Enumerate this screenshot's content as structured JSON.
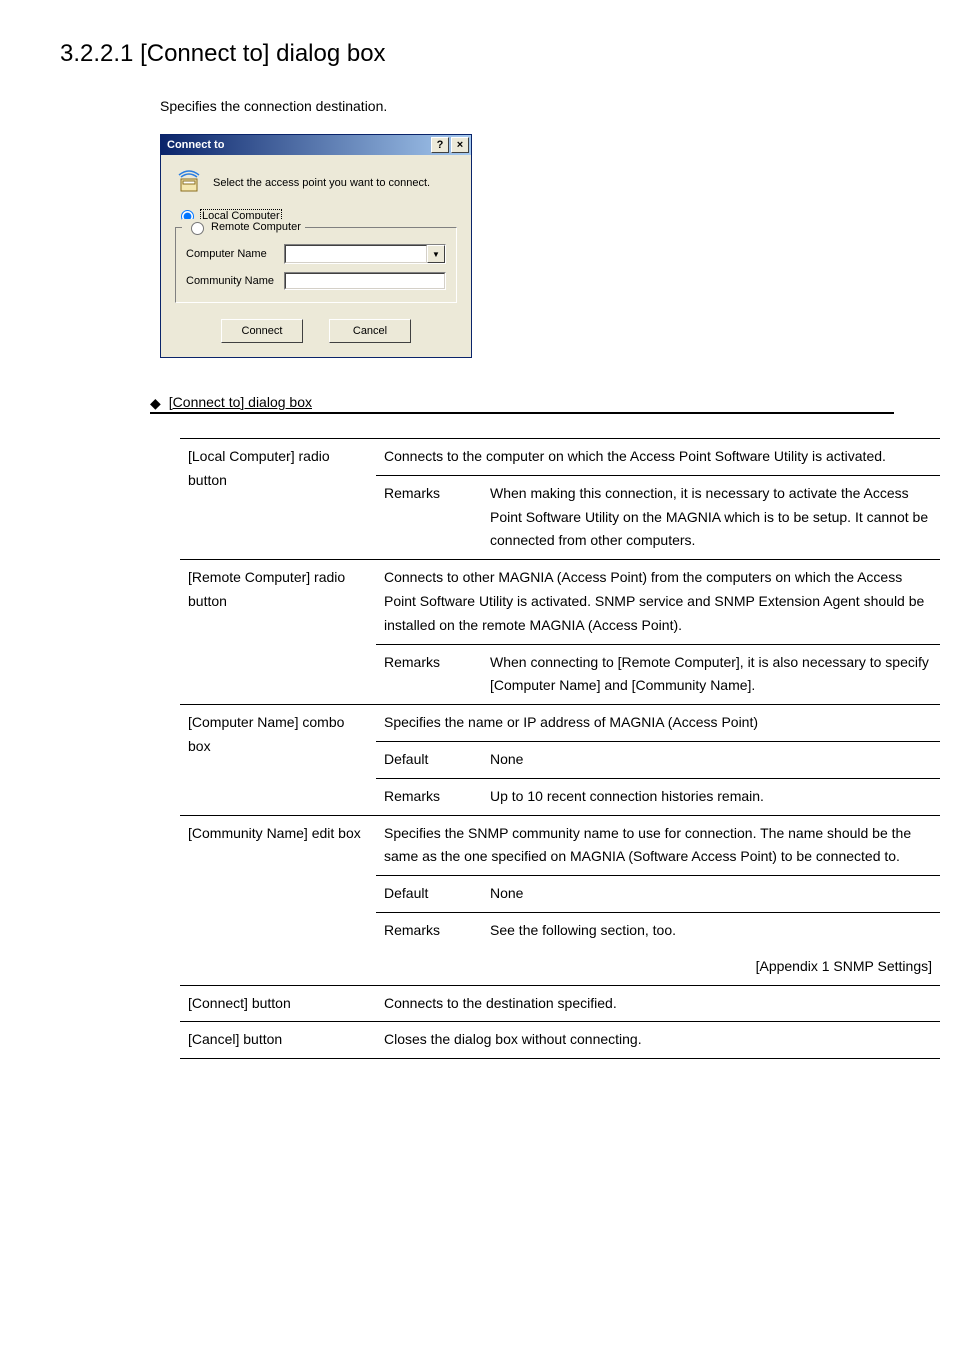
{
  "heading": "3.2.2.1 [Connect to] dialog box",
  "intro": "Specifies the connection destination.",
  "dialog": {
    "title": "Connect to",
    "help_btn": "?",
    "close_btn": "×",
    "prompt": "Select the access point you want to connect.",
    "local_label": "Local Computer",
    "remote_label": "Remote Computer",
    "computer_name_label": "Computer Name",
    "community_name_label": "Community Name",
    "connect_btn": "Connect",
    "cancel_btn": "Cancel",
    "combo_arrow": "▼"
  },
  "section_title": "[Connect to] dialog box",
  "rows": {
    "local": {
      "name": "[Local Computer] radio button",
      "desc": "Connects to the computer on which the Access Point Software Utility is activated.",
      "remarks_label": "Remarks",
      "remarks": "When making this connection, it is necessary to activate the Access Point Software Utility on the MAGNIA which is to be setup.  It cannot be connected from other computers."
    },
    "remote": {
      "name": "[Remote Computer] radio button",
      "desc": "Connects to other MAGNIA (Access Point) from the computers on which the Access Point Software Utility is activated. SNMP service and SNMP Extension Agent should be installed on the remote MAGNIA (Access Point).",
      "remarks_label": "Remarks",
      "remarks": "When connecting to [Remote Computer], it is also necessary to specify [Computer Name] and [Community Name]."
    },
    "computer_name": {
      "name": "[Computer Name] combo box",
      "desc": "Specifies the name or IP address of MAGNIA (Access Point)",
      "default_label": "Default",
      "default_val": "None",
      "remarks_label": "Remarks",
      "remarks": "Up to 10 recent connection histories remain."
    },
    "community_name": {
      "name": "[Community Name] edit box",
      "desc": "Specifies the SNMP community name to use for connection. The name should be the same as the one specified on MAGNIA (Software Access Point) to be connected to.",
      "default_label": "Default",
      "default_val": "None",
      "remarks_label": "Remarks",
      "remarks": "See the following section, too.",
      "xref": "[Appendix 1  SNMP Settings]"
    },
    "connect_btn": {
      "name": "[Connect] button",
      "desc": "Connects to the destination specified."
    },
    "cancel_btn": {
      "name": "[Cancel] button",
      "desc": "Closes the dialog box without connecting."
    }
  }
}
